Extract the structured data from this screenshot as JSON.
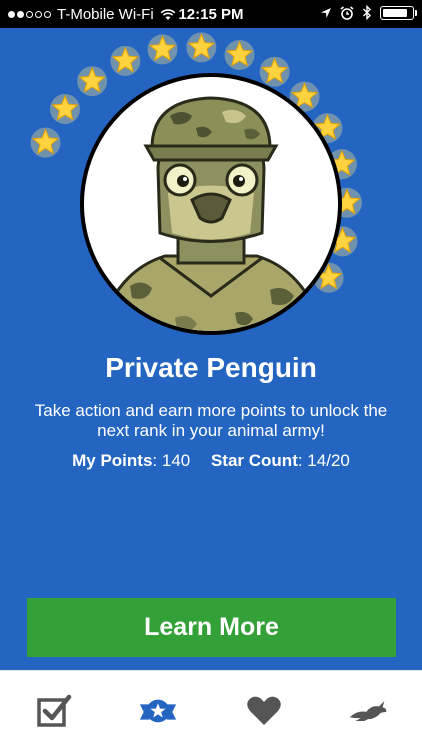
{
  "status_bar": {
    "carrier": "T-Mobile Wi-Fi",
    "time": "12:15 PM",
    "signal_filled": 2,
    "signal_total": 5,
    "battery_level": 0.9
  },
  "rank": {
    "title": "Private Penguin",
    "description": "Take action and earn more points to unlock the next rank in your animal army!",
    "stars_earned": 14,
    "stars_total": 20
  },
  "stats": {
    "points_label": "My Points",
    "points_value": ": 140",
    "stars_label": "Star Count",
    "stars_value": ": 14/20"
  },
  "cta": {
    "label": "Learn More"
  },
  "tabs": [
    {
      "icon": "checkbox-icon"
    },
    {
      "icon": "rank-badge-icon",
      "active": true
    },
    {
      "icon": "heart-icon"
    },
    {
      "icon": "rabbit-icon"
    }
  ],
  "colors": {
    "background": "#2465c1",
    "cta": "#33a138",
    "tab_icon": "#555555",
    "tab_active": "#2465c1",
    "star": "#ffd23f"
  }
}
